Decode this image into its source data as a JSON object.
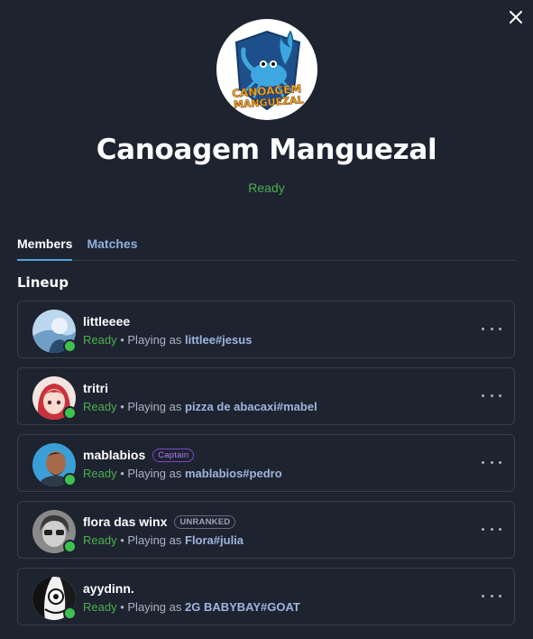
{
  "header": {
    "close_icon": "close-icon",
    "team_name": "Canoagem Manguezal",
    "status": "Ready",
    "logo_text_1": "CANOAGEM",
    "logo_text_2": "MANGUEZAL"
  },
  "tabs": [
    {
      "label": "Members",
      "active": true
    },
    {
      "label": "Matches",
      "active": false
    }
  ],
  "lineup": {
    "title": "Lineup",
    "members": [
      {
        "name": "littleeee",
        "badge": "",
        "status": "Ready",
        "separator": "•",
        "playing_prefix": "Playing as",
        "gamer_tag": "littlee#jesus",
        "online": true
      },
      {
        "name": "tritri",
        "badge": "",
        "status": "Ready",
        "separator": "•",
        "playing_prefix": "Playing as",
        "gamer_tag": "pizza de abacaxi#mabel",
        "online": true
      },
      {
        "name": "mablabios",
        "badge": "Captain",
        "status": "Ready",
        "separator": "•",
        "playing_prefix": "Playing as",
        "gamer_tag": "mablabios#pedro",
        "online": true
      },
      {
        "name": "flora das winx",
        "badge": "UNRANKED",
        "status": "Ready",
        "separator": "•",
        "playing_prefix": "Playing as",
        "gamer_tag": "Flora#julia",
        "online": true
      },
      {
        "name": "ayydinn.",
        "badge": "",
        "status": "Ready",
        "separator": "•",
        "playing_prefix": "Playing as",
        "gamer_tag": "2G BABYBAY#GOAT",
        "online": true
      }
    ]
  },
  "colors": {
    "background": "#1e2330",
    "ready_green": "#4caf50",
    "tab_active_underline": "#4fa3d9",
    "captain_purple": "#7b49c9"
  }
}
